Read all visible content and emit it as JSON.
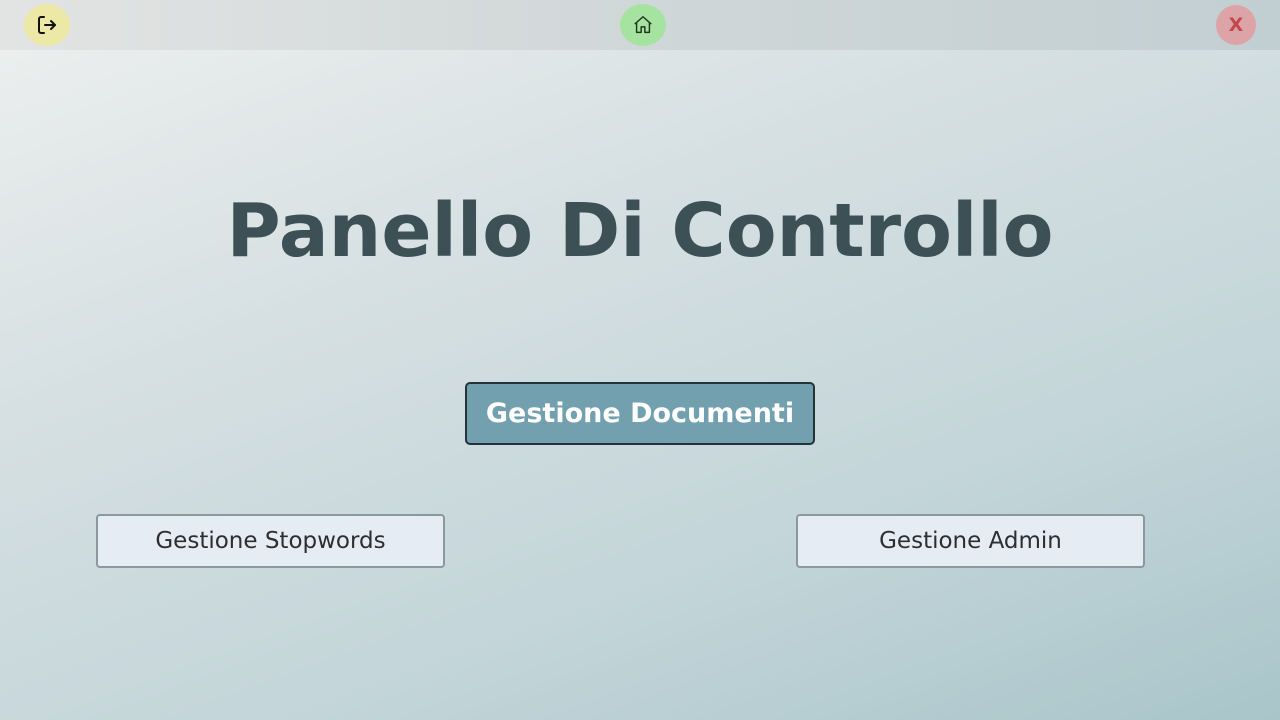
{
  "topbar": {
    "logout_icon": "logout-icon",
    "home_icon": "home-icon",
    "close_label": "X",
    "colors": {
      "logout_bg": "#ece9a6",
      "home_bg": "#a7e3a0",
      "close_bg": "#dca4a7",
      "close_text": "#c4474d"
    }
  },
  "main": {
    "title": "Panello Di Controllo",
    "primary_button": "Gestione Documenti",
    "stopwords_button": "Gestione Stopwords",
    "admin_button": "Gestione Admin",
    "colors": {
      "title": "#3d5056",
      "primary_bg": "#73a0ae",
      "secondary_bg": "#e5ecf4"
    }
  }
}
